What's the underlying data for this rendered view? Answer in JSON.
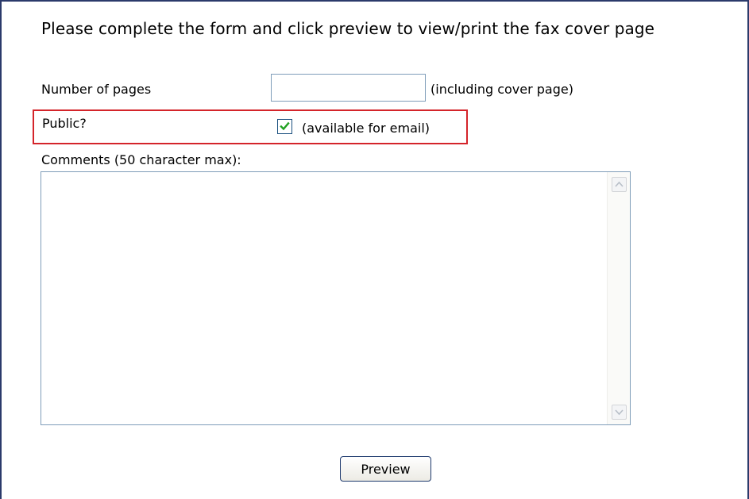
{
  "form": {
    "intro_text": "Please complete the form and click preview to view/print the fax cover page",
    "pages": {
      "label": "Number of pages",
      "value": "",
      "hint": "(including cover page)"
    },
    "public": {
      "label": "Public?",
      "checked": true,
      "hint": "(available for email)",
      "highlight_color": "#d4242a"
    },
    "comments": {
      "label": "Comments (50 character max):",
      "value": ""
    },
    "preview_button_label": "Preview"
  },
  "icons": {
    "checkbox": "check-icon",
    "scroll_up": "scroll-up-arrow-icon",
    "scroll_down": "scroll-down-arrow-icon"
  },
  "colors": {
    "frame_border": "#2b3a6b",
    "input_border": "#7f9db9",
    "checkmark": "#21a121"
  }
}
